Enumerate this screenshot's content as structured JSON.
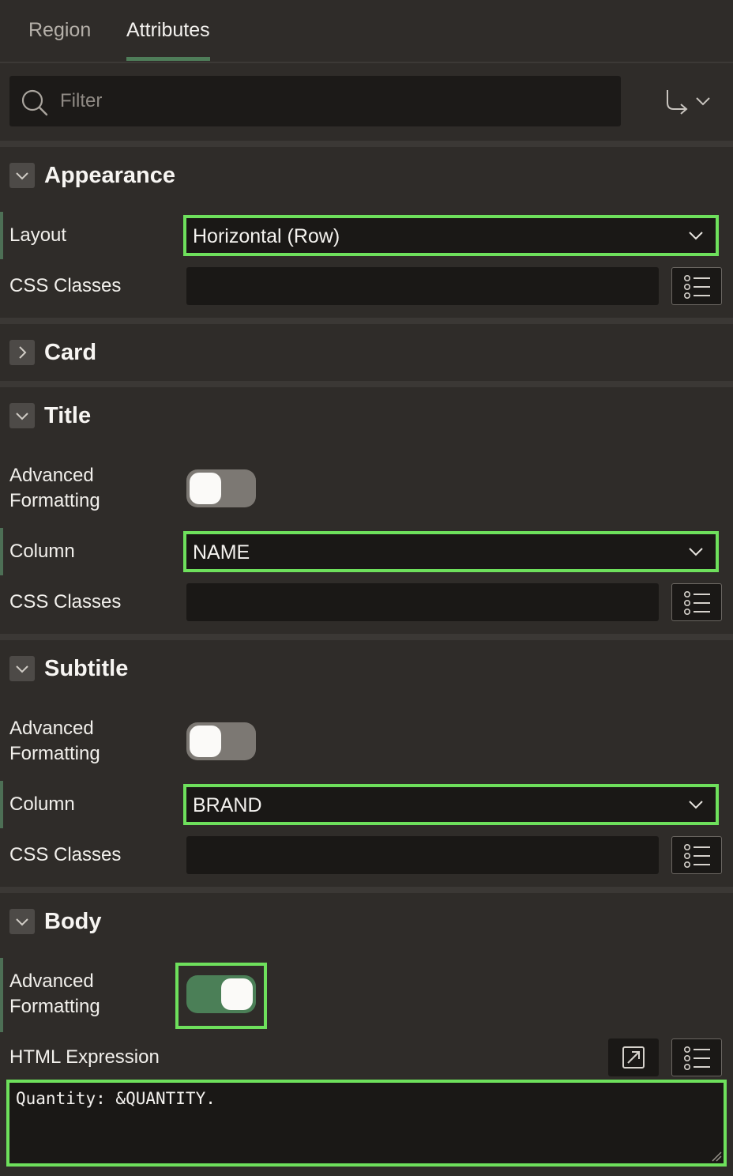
{
  "tabs": [
    {
      "label": "Region",
      "active": false
    },
    {
      "label": "Attributes",
      "active": true
    }
  ],
  "filter": {
    "placeholder": "Filter"
  },
  "sections": {
    "appearance": {
      "title": "Appearance",
      "expanded": true,
      "layout_label": "Layout",
      "layout_value": "Horizontal (Row)",
      "css_label": "CSS Classes"
    },
    "card": {
      "title": "Card",
      "expanded": false
    },
    "title": {
      "title": "Title",
      "expanded": true,
      "adv_label_1": "Advanced",
      "adv_label_2": "Formatting",
      "adv_on": false,
      "column_label": "Column",
      "column_value": "NAME",
      "css_label": "CSS Classes"
    },
    "subtitle": {
      "title": "Subtitle",
      "expanded": true,
      "adv_label_1": "Advanced",
      "adv_label_2": "Formatting",
      "adv_on": false,
      "column_label": "Column",
      "column_value": "BRAND",
      "css_label": "CSS Classes"
    },
    "body": {
      "title": "Body",
      "expanded": true,
      "adv_label_1": "Advanced",
      "adv_label_2": "Formatting",
      "adv_on": true,
      "html_label": "HTML Expression",
      "html_value": "Quantity: &QUANTITY."
    }
  },
  "colors": {
    "background": "#2f2c29",
    "field": "#1a1816",
    "highlight": "#6ee05c",
    "accent_green": "#4b7f57"
  }
}
